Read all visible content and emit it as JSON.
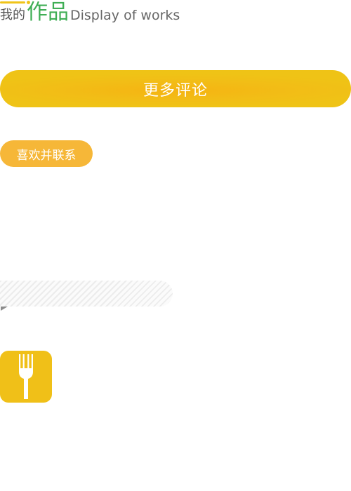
{
  "header": {
    "title_prefix": "我的",
    "title_main": "作品",
    "title_en": "Display of works"
  },
  "more_comments_button": {
    "label": "更多评论"
  },
  "like_contact_button": {
    "label": "喜欢并联系"
  },
  "fork_tile": {
    "icon": "fork-icon"
  },
  "colors": {
    "accent_yellow": "#f0c419",
    "pill_orange": "#f6b738",
    "title_green": "#3fae55",
    "text_gray": "#555555",
    "tile_yellow": "#f0c018"
  }
}
